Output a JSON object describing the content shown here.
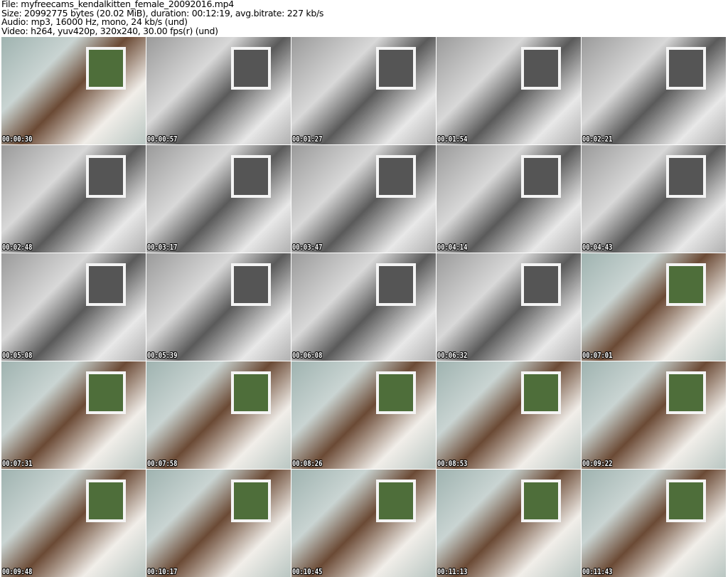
{
  "header": {
    "file": "File: myfreecams_kendalkitten_female_20092016.mp4",
    "size": "Size: 20992775 bytes (20.02 MiB), duration: 00:12:19, avg.bitrate: 227 kb/s",
    "audio": "Audio: mp3, 16000 Hz, mono, 24 kb/s (und)",
    "video": "Video: h264, yuv420p, 320x240, 30.00 fps(r) (und)"
  },
  "thumbnails": [
    {
      "time": "00:00:30",
      "tone": "color"
    },
    {
      "time": "00:00:57",
      "tone": "gray"
    },
    {
      "time": "00:01:27",
      "tone": "gray"
    },
    {
      "time": "00:01:54",
      "tone": "gray"
    },
    {
      "time": "00:02:21",
      "tone": "gray"
    },
    {
      "time": "00:02:48",
      "tone": "gray"
    },
    {
      "time": "00:03:17",
      "tone": "gray"
    },
    {
      "time": "00:03:47",
      "tone": "gray"
    },
    {
      "time": "00:04:14",
      "tone": "gray"
    },
    {
      "time": "00:04:43",
      "tone": "gray"
    },
    {
      "time": "00:05:08",
      "tone": "gray"
    },
    {
      "time": "00:05:39",
      "tone": "gray"
    },
    {
      "time": "00:06:08",
      "tone": "gray"
    },
    {
      "time": "00:06:32",
      "tone": "gray"
    },
    {
      "time": "00:07:01",
      "tone": "color"
    },
    {
      "time": "00:07:31",
      "tone": "color"
    },
    {
      "time": "00:07:58",
      "tone": "color"
    },
    {
      "time": "00:08:26",
      "tone": "color"
    },
    {
      "time": "00:08:53",
      "tone": "color"
    },
    {
      "time": "00:09:22",
      "tone": "color"
    },
    {
      "time": "00:09:48",
      "tone": "color"
    },
    {
      "time": "00:10:17",
      "tone": "color"
    },
    {
      "time": "00:10:45",
      "tone": "color"
    },
    {
      "time": "00:11:13",
      "tone": "color"
    },
    {
      "time": "00:11:43",
      "tone": "color"
    }
  ]
}
